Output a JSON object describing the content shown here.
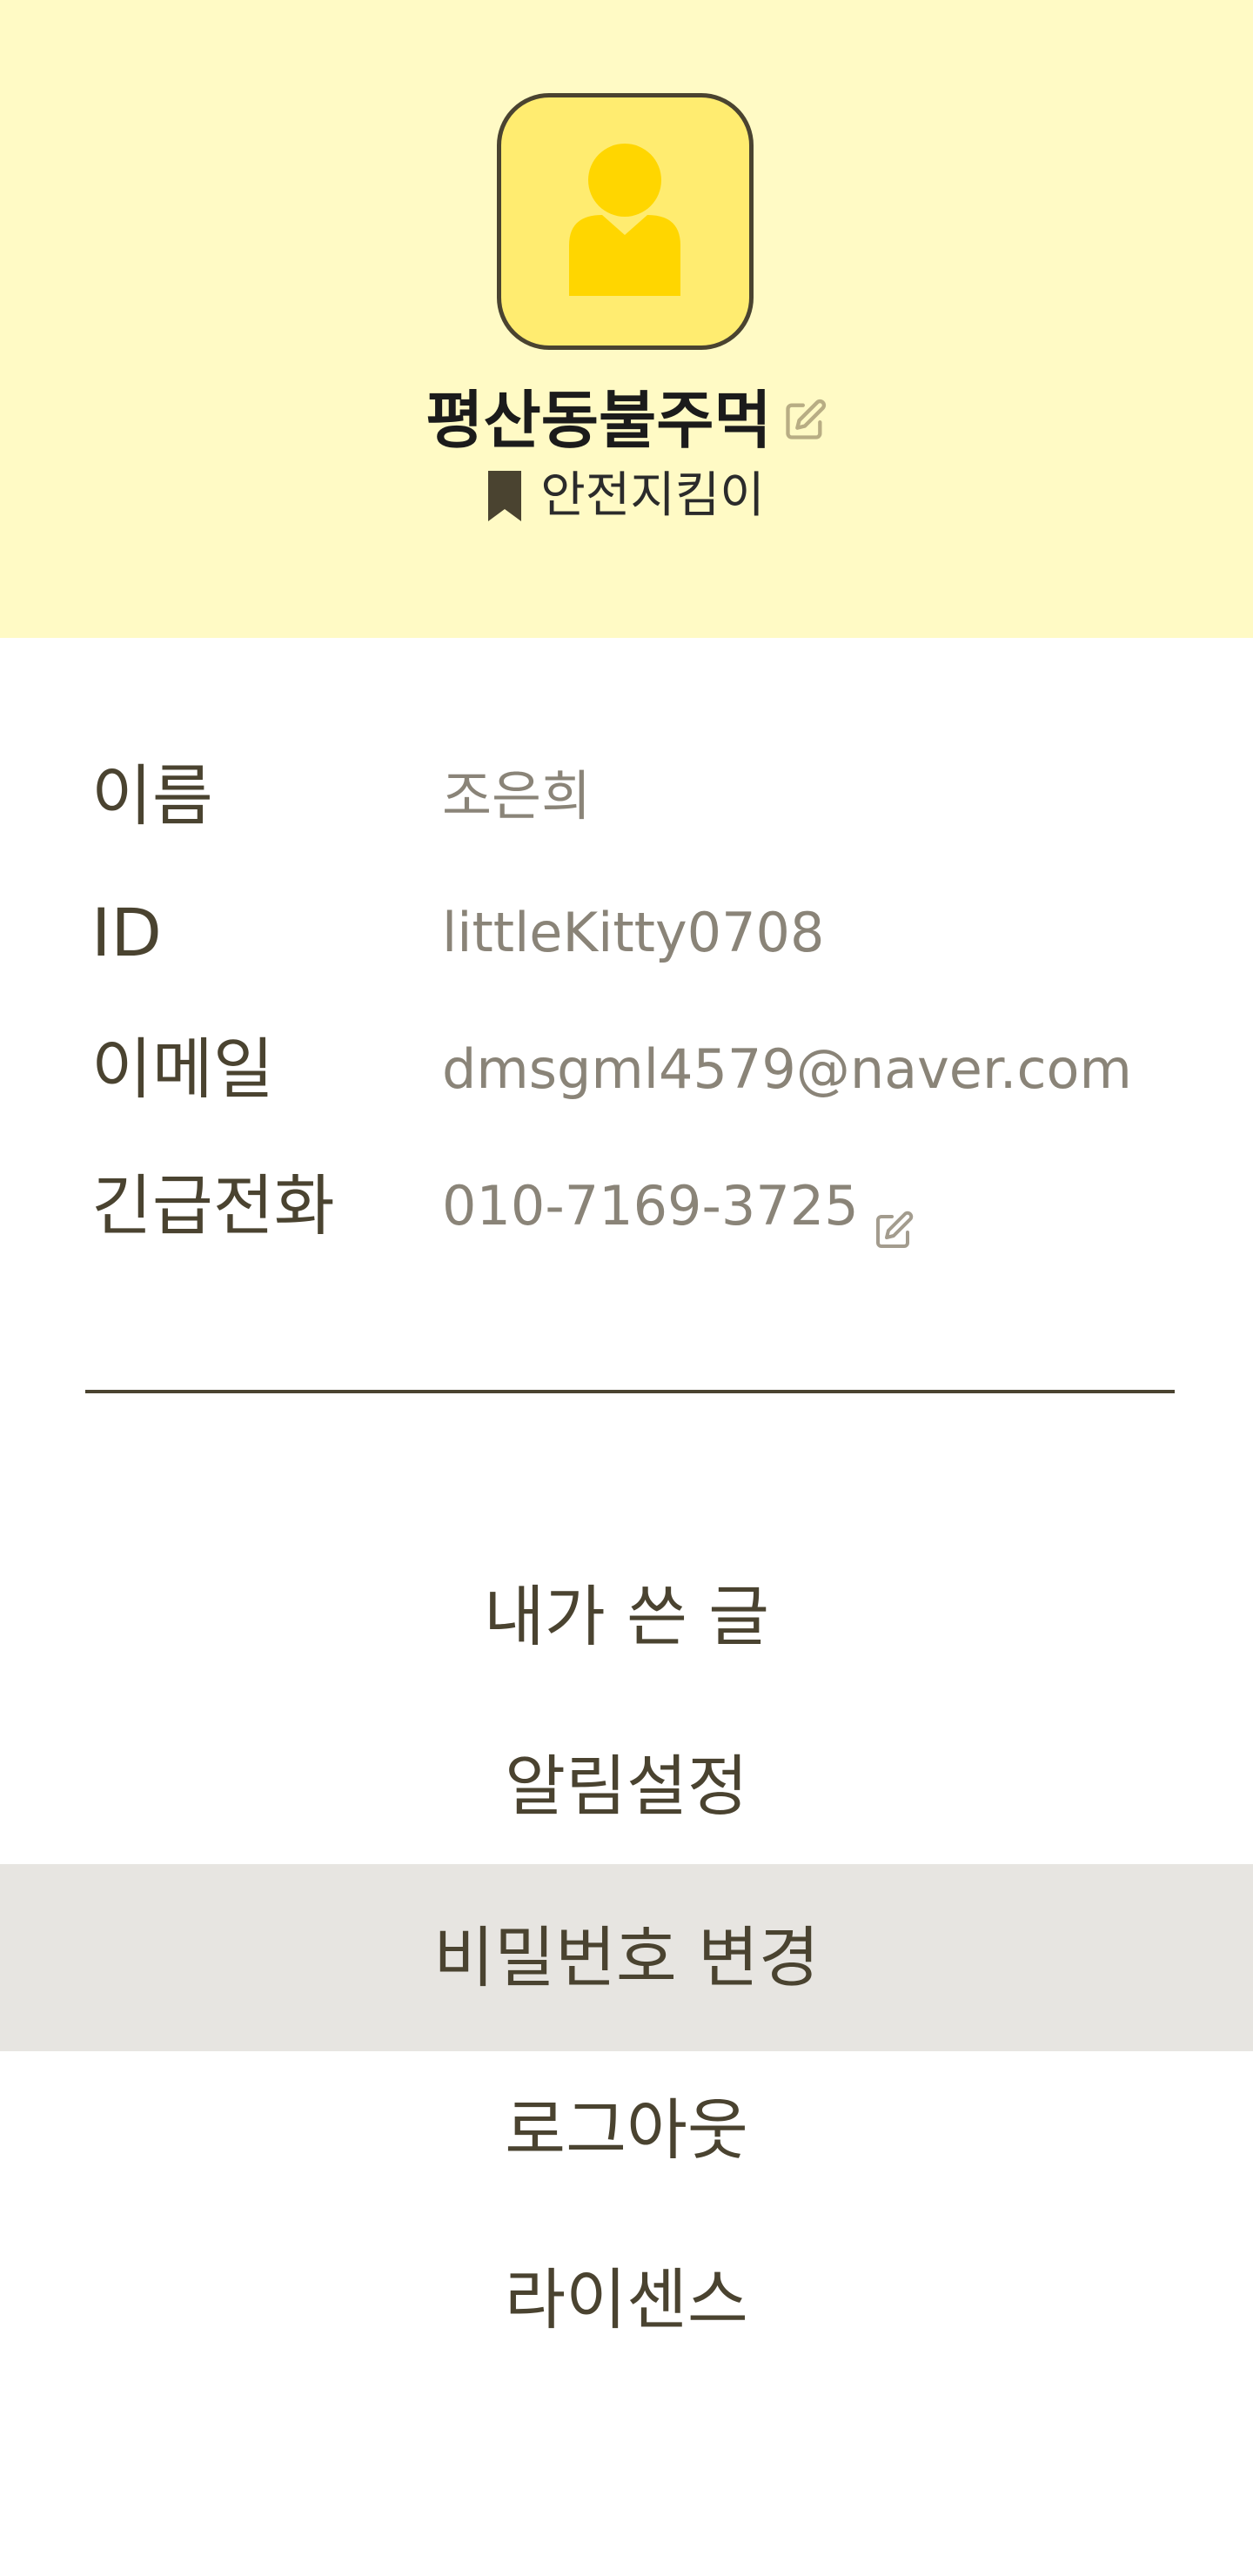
{
  "profile": {
    "nickname": "평산동불주먹",
    "badge": "안전지킴이",
    "avatar_icon": "user-avatar-icon",
    "edit_icon": "edit-icon",
    "badge_icon": "bookmark-icon"
  },
  "info": {
    "name_label": "이름",
    "name_value": "조은희",
    "id_label": "ID",
    "id_value": "littleKitty0708",
    "email_label": "이메일",
    "email_value": "dmsgml4579@naver.com",
    "phone_label": "긴급전화",
    "phone_value": "010-7169-3725"
  },
  "menu": {
    "items": [
      {
        "label": "내가 쓴 글"
      },
      {
        "label": "알림설정"
      },
      {
        "label": "비밀번호 변경"
      },
      {
        "label": "로그아웃"
      },
      {
        "label": "라이센스"
      }
    ],
    "active_index": 2
  },
  "colors": {
    "header_bg": "#fffac5",
    "avatar_bg": "#ffec70",
    "avatar_figure": "#ffd600",
    "text_dark": "#4a4330",
    "text_muted": "#8a8478",
    "active_bg": "#e7e5e1"
  }
}
